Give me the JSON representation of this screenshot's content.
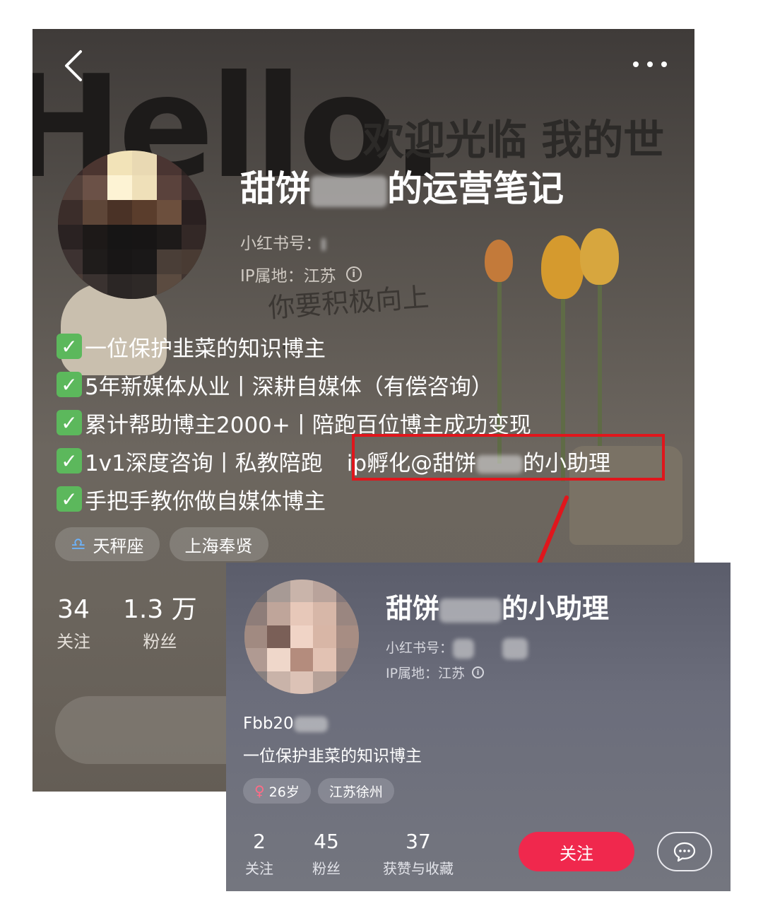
{
  "main_profile": {
    "name_prefix": "甜饼",
    "name_suffix": "的运营笔记",
    "id_label": "小红书号：",
    "ip_label": "IP属地：江苏",
    "background_text": {
      "hello": "Hello.",
      "welcome": "欢迎光临 我的世",
      "handwriting_line1": "你要积极向上",
      "handwriting_line2": "…"
    },
    "bio": [
      "一位保护韭菜的知识博主",
      "5年新媒体从业丨深耕自媒体（有偿咨询）",
      "累计帮助博主2000+丨陪跑百位博主成功变现",
      "1v1深度咨询丨私教陪跑"
    ],
    "bio_highlight_prefix": "ip孵化@甜饼",
    "bio_highlight_suffix": "的小助理",
    "bio_last": "手把手教你做自媒体博主",
    "check_glyph": "✓",
    "tags": [
      {
        "icon": "libra-zodiac-icon",
        "glyph": "♎",
        "label": "天秤座"
      },
      {
        "label": "上海奉贤"
      }
    ],
    "stats": [
      {
        "value": "34",
        "label": "关注"
      },
      {
        "value": "1.3 万",
        "label": "粉丝"
      }
    ]
  },
  "assistant_profile": {
    "name_prefix": "甜饼",
    "name_suffix": "的小助理",
    "id_label": "小红书号：",
    "ip_label": "IP属地：江苏",
    "handle": "Fbb20",
    "bio": "一位保护韭菜的知识博主",
    "tags": [
      {
        "icon": "female-icon",
        "glyph": "♀",
        "label": "26岁"
      },
      {
        "label": "江苏徐州"
      }
    ],
    "stats": [
      {
        "value": "2",
        "label": "关注"
      },
      {
        "value": "45",
        "label": "粉丝"
      },
      {
        "value": "37",
        "label": "获赞与收藏"
      }
    ],
    "follow_label": "关注"
  },
  "colors": {
    "highlight_border": "#e0161c",
    "follow_button": "#f0284d",
    "check_green": "#5cb85c"
  }
}
